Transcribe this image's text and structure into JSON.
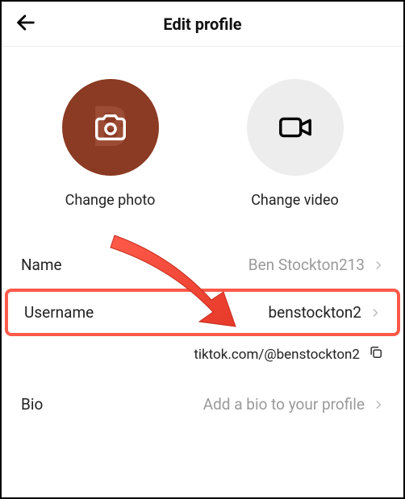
{
  "header": {
    "title": "Edit profile"
  },
  "media": {
    "photo_label": "Change photo",
    "video_label": "Change video",
    "avatar_letter": "B"
  },
  "rows": {
    "name": {
      "label": "Name",
      "value": "Ben Stockton213"
    },
    "username": {
      "label": "Username",
      "value": "benstockton2"
    },
    "bio": {
      "label": "Bio",
      "placeholder": "Add a bio to your profile"
    }
  },
  "url": {
    "text": "tiktok.com/@benstockton2"
  }
}
